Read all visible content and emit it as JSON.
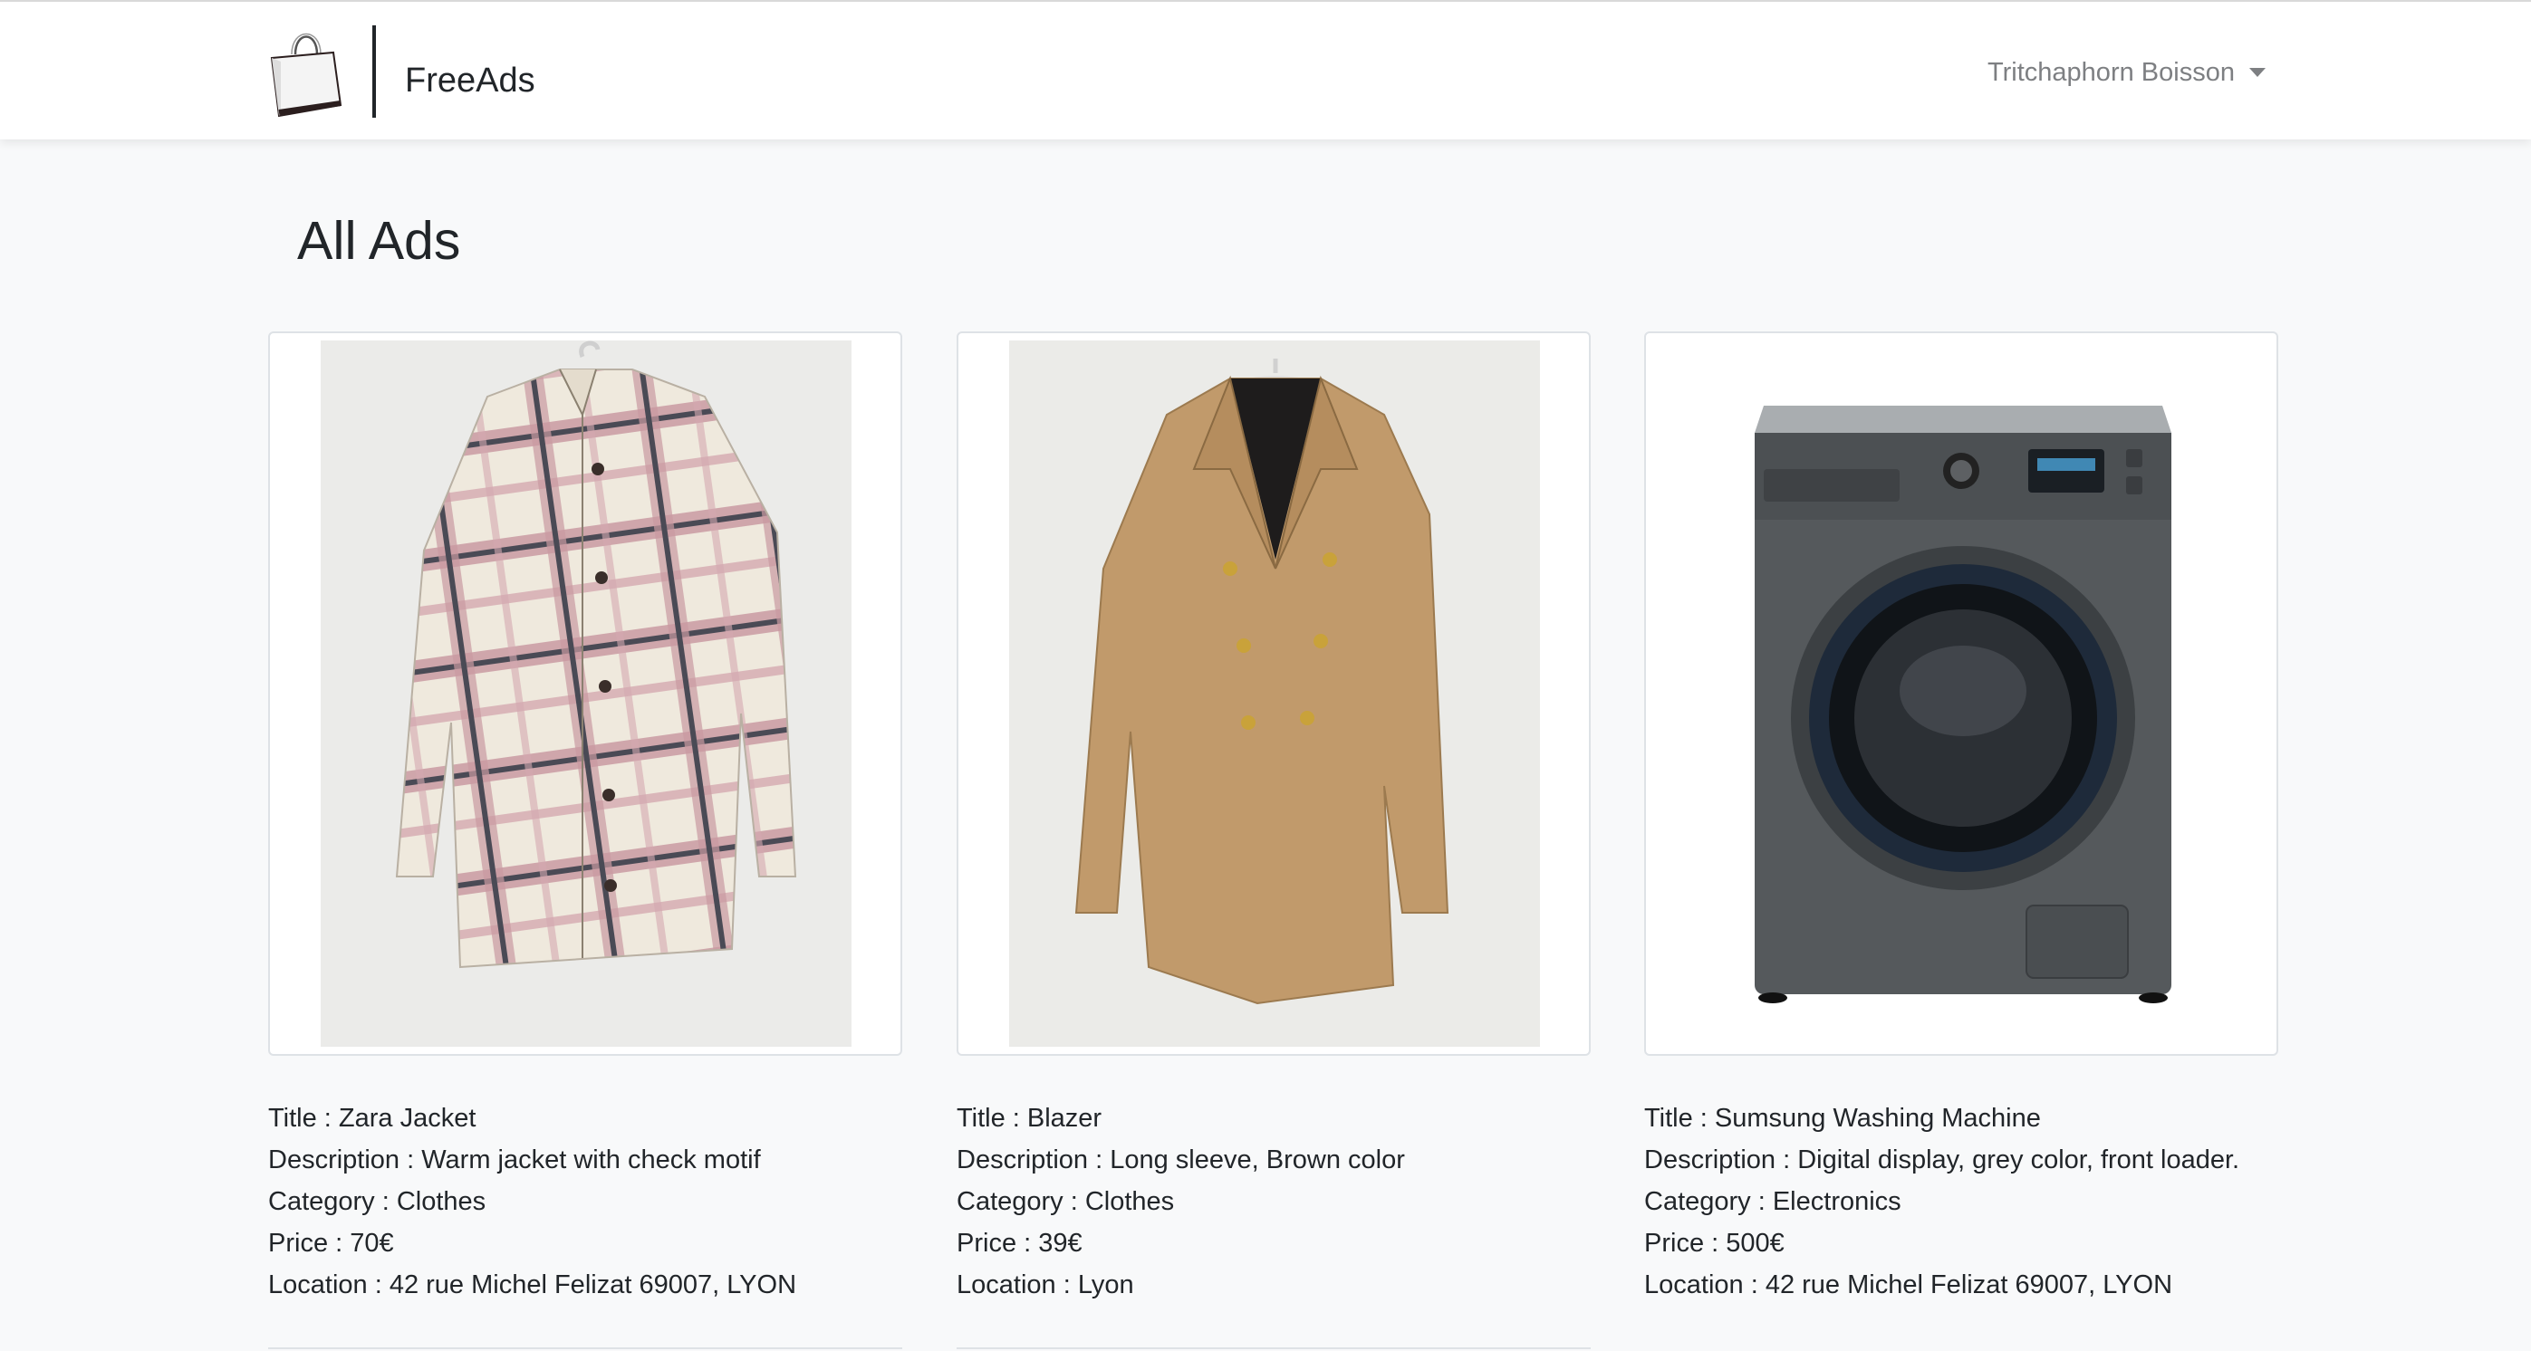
{
  "navbar": {
    "brand_name": "FreeAds",
    "user_name": "Tritchaphorn Boisson",
    "logo_icon": "shopping-bag-icon",
    "user_caret_icon": "caret-down-icon"
  },
  "page": {
    "title": "All Ads"
  },
  "labels": {
    "title": "Title : ",
    "description": "Description : ",
    "category": "Category : ",
    "price": "Price : ",
    "location": "Location : "
  },
  "ads": [
    {
      "image": "plaid-jacket-photo",
      "title": "Zara Jacket",
      "description": "Warm jacket with check motif",
      "category": "Clothes",
      "price": "70€",
      "location": "42 rue Michel Felizat 69007, LYON"
    },
    {
      "image": "camel-blazer-photo",
      "title": "Blazer",
      "description": "Long sleeve, Brown color",
      "category": "Clothes",
      "price": "39€",
      "location": "Lyon"
    },
    {
      "image": "washing-machine-photo",
      "title": "Sumsung Washing Machine",
      "description": "Digital display, grey color, front loader.",
      "category": "Electronics",
      "price": "500€",
      "location": "42 rue Michel Felizat 69007, LYON"
    }
  ],
  "colors": {
    "page_bg": "#f8f9fa",
    "navbar_bg": "#ffffff",
    "text": "#212529",
    "muted_text": "#7d7f82",
    "card_border": "#dee2e6"
  }
}
